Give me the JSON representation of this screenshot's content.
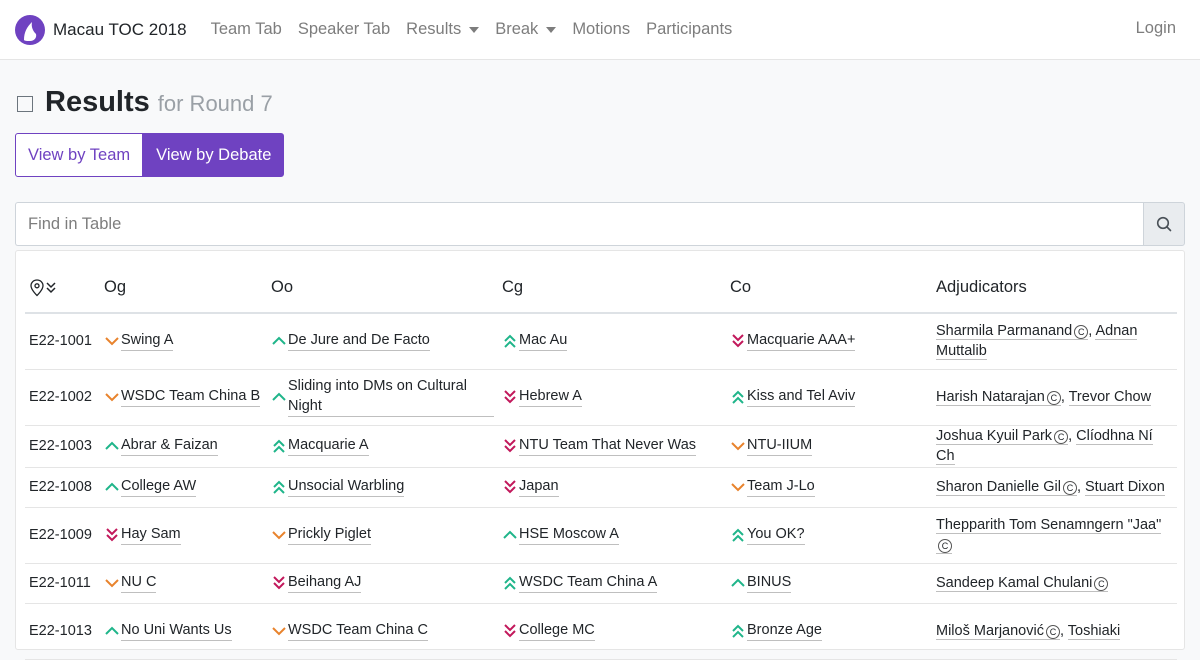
{
  "nav": {
    "brand": "Macau TOC 2018",
    "links": [
      "Team Tab",
      "Speaker Tab",
      "Results",
      "Break",
      "Motions",
      "Participants"
    ],
    "login": "Login"
  },
  "heading": {
    "title": "Results",
    "subtitle": "for Round 7"
  },
  "toggle": {
    "by_team": "View by Team",
    "by_debate": "View by Debate"
  },
  "search": {
    "placeholder": "Find in Table"
  },
  "table": {
    "headers": [
      "Og",
      "Oo",
      "Cg",
      "Co",
      "Adjudicators"
    ],
    "rows": [
      {
        "code": "E22-1001",
        "teams": [
          {
            "name": "Swing A",
            "rank": "3rd"
          },
          {
            "name": "De Jure and De Facto",
            "rank": "2nd"
          },
          {
            "name": "Mac Au",
            "rank": "1st"
          },
          {
            "name": "Macquarie AAA+",
            "rank": "4th"
          }
        ],
        "adj": [
          "Sharmila Parmanand",
          "Adnan Muttalib"
        ]
      },
      {
        "code": "E22-1002",
        "teams": [
          {
            "name": "WSDC Team China B",
            "rank": "3rd"
          },
          {
            "name": "Sliding into DMs on Cultural Night",
            "rank": "2nd"
          },
          {
            "name": "Hebrew A",
            "rank": "4th"
          },
          {
            "name": "Kiss and Tel Aviv",
            "rank": "1st"
          }
        ],
        "adj": [
          "Harish Natarajan",
          "Trevor Chow"
        ]
      },
      {
        "code": "E22-1003",
        "teams": [
          {
            "name": "Abrar & Faizan",
            "rank": "2nd"
          },
          {
            "name": "Macquarie A",
            "rank": "1st"
          },
          {
            "name": "NTU Team That Never Was",
            "rank": "4th"
          },
          {
            "name": "NTU-IIUM",
            "rank": "3rd"
          }
        ],
        "adj": [
          "Joshua Kyuil Park",
          "Clíodhna Ní Ch"
        ]
      },
      {
        "code": "E22-1008",
        "teams": [
          {
            "name": "College AW",
            "rank": "2nd"
          },
          {
            "name": "Unsocial Warbling",
            "rank": "1st"
          },
          {
            "name": "Japan",
            "rank": "4th"
          },
          {
            "name": "Team J-Lo",
            "rank": "3rd"
          }
        ],
        "adj": [
          "Sharon Danielle Gil",
          "Stuart Dixon"
        ]
      },
      {
        "code": "E22-1009",
        "teams": [
          {
            "name": "Hay Sam",
            "rank": "4th"
          },
          {
            "name": "Prickly Piglet",
            "rank": "3rd"
          },
          {
            "name": "HSE Moscow A",
            "rank": "2nd"
          },
          {
            "name": "You OK?",
            "rank": "1st"
          }
        ],
        "adj": [
          "Thepparith Tom Senamngern \"Jaa\""
        ]
      },
      {
        "code": "E22-1011",
        "teams": [
          {
            "name": "NU C",
            "rank": "3rd"
          },
          {
            "name": "Beihang AJ",
            "rank": "4th"
          },
          {
            "name": "WSDC Team China A",
            "rank": "1st"
          },
          {
            "name": "BINUS",
            "rank": "2nd"
          }
        ],
        "adj": [
          "Sandeep Kamal Chulani"
        ]
      },
      {
        "code": "E22-1013",
        "teams": [
          {
            "name": "No Uni Wants Us",
            "rank": "2nd"
          },
          {
            "name": "WSDC Team China C",
            "rank": "3rd"
          },
          {
            "name": "College MC",
            "rank": "4th"
          },
          {
            "name": "Bronze Age",
            "rank": "1st"
          }
        ],
        "adj": [
          "Miloš Marjanović",
          "Toshiaki"
        ]
      }
    ]
  },
  "colors": {
    "accent": "#6f42c1",
    "first": "#1fb58a",
    "second": "#1fb58a",
    "third": "#e8832d",
    "fourth": "#c2185b"
  }
}
